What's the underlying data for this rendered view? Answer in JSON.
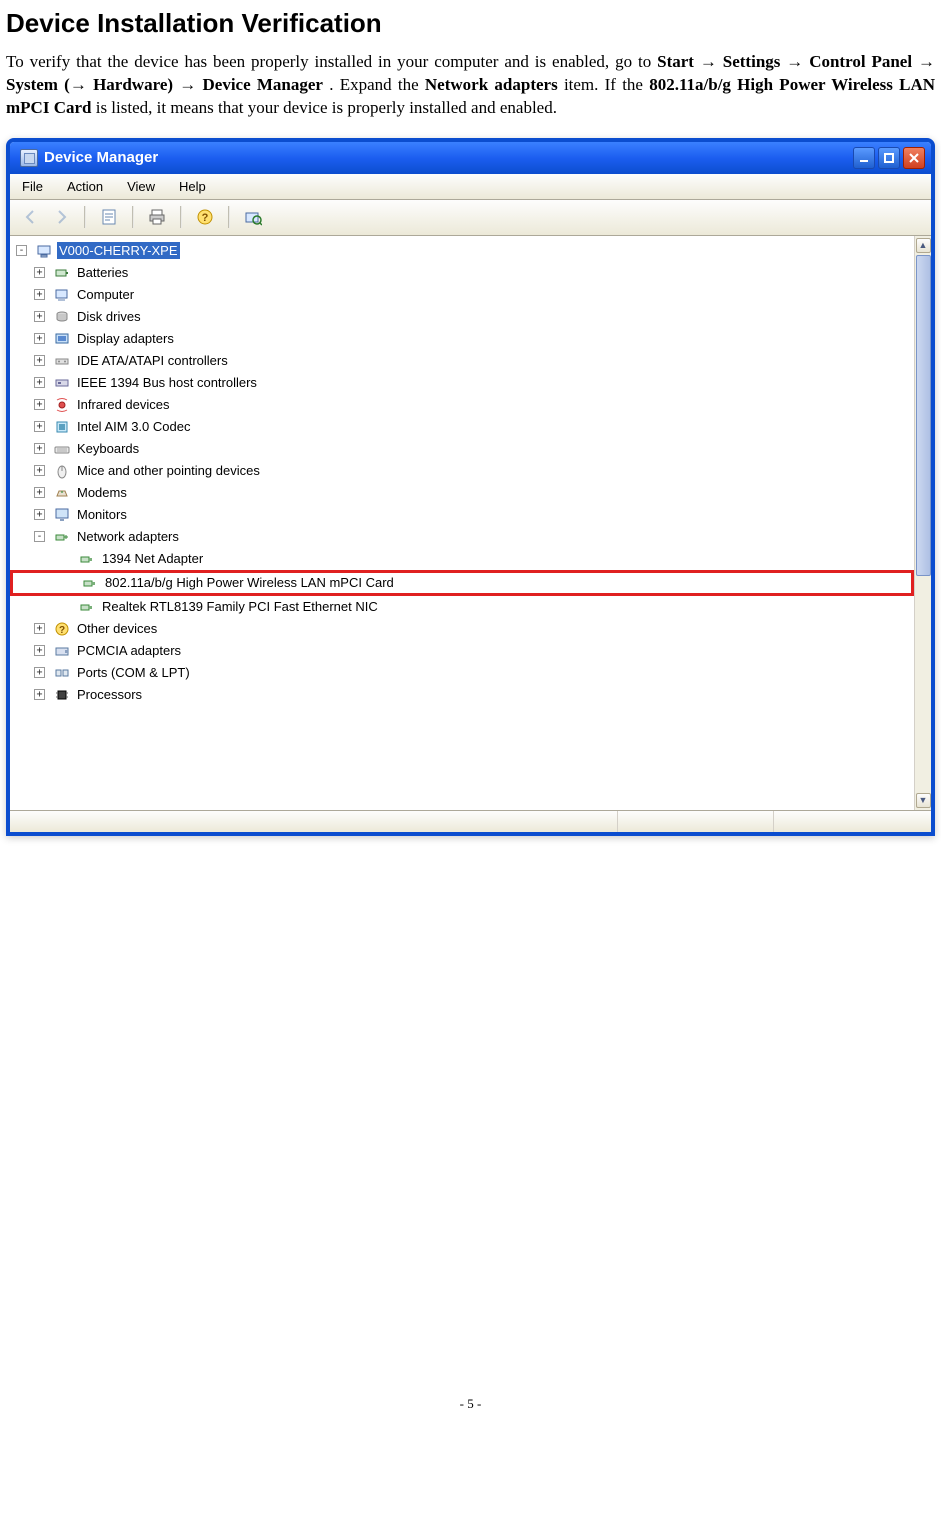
{
  "page": {
    "heading": "Device Installation Verification",
    "intro_plain": "To verify that the device has been properly installed in your computer and is enabled, go to Start → Settings → Control Panel → System (→ Hardware) → Device Manager. Expand the Network adapters item. If the 802.11a/b/g High Power Wireless LAN mPCI Card is listed, it means that your device is properly installed and enabled.",
    "intro_parts": {
      "p1": "To verify that the device has been properly installed in your computer and is enabled, go to ",
      "b1": "Start → Settings → Control Panel → System (→ Hardware) → Device Manager",
      "p2": ". Expand the ",
      "b2": "Network adapters",
      "p3": " item. If the ",
      "b3": "802.11a/b/g High Power Wireless LAN mPCI Card",
      "p4": " is listed, it means that your device is properly installed and enabled."
    },
    "footer": "- 5 -"
  },
  "window": {
    "title": "Device Manager"
  },
  "menubar": [
    {
      "label": "File"
    },
    {
      "label": "Action"
    },
    {
      "label": "View"
    },
    {
      "label": "Help"
    }
  ],
  "toolbar": [
    {
      "name": "back",
      "enabled": false,
      "icon": "arrow-left"
    },
    {
      "name": "forward",
      "enabled": false,
      "icon": "arrow-right"
    },
    {
      "sep": true
    },
    {
      "name": "properties",
      "enabled": true,
      "icon": "properties"
    },
    {
      "sep": true
    },
    {
      "name": "print",
      "enabled": true,
      "icon": "print"
    },
    {
      "sep": true
    },
    {
      "name": "help",
      "enabled": true,
      "icon": "help"
    },
    {
      "sep": true
    },
    {
      "name": "scan",
      "enabled": true,
      "icon": "scan"
    }
  ],
  "tree": {
    "root": {
      "icon": "computer-root",
      "label": "V000-CHERRY-XPE",
      "selected": true
    },
    "nodes": [
      {
        "exp": "+",
        "icon": "battery",
        "label": "Batteries"
      },
      {
        "exp": "+",
        "icon": "computer",
        "label": "Computer"
      },
      {
        "exp": "+",
        "icon": "disk",
        "label": "Disk drives"
      },
      {
        "exp": "+",
        "icon": "display",
        "label": "Display adapters"
      },
      {
        "exp": "+",
        "icon": "ide",
        "label": "IDE ATA/ATAPI controllers"
      },
      {
        "exp": "+",
        "icon": "ieee1394",
        "label": "IEEE 1394 Bus host controllers"
      },
      {
        "exp": "+",
        "icon": "infrared",
        "label": "Infrared devices"
      },
      {
        "exp": "+",
        "icon": "chip",
        "label": "Intel AIM 3.0 Codec"
      },
      {
        "exp": "+",
        "icon": "keyboard",
        "label": "Keyboards"
      },
      {
        "exp": "+",
        "icon": "mouse",
        "label": "Mice and other pointing devices"
      },
      {
        "exp": "+",
        "icon": "modem",
        "label": "Modems"
      },
      {
        "exp": "+",
        "icon": "monitor",
        "label": "Monitors"
      },
      {
        "exp": "-",
        "icon": "network",
        "label": "Network adapters",
        "children": [
          {
            "icon": "netcard",
            "label": "1394 Net Adapter"
          },
          {
            "icon": "netcard",
            "label": "802.11a/b/g High Power Wireless LAN mPCI Card",
            "highlight": true
          },
          {
            "icon": "netcard",
            "label": "Realtek RTL8139 Family PCI Fast Ethernet NIC"
          }
        ]
      },
      {
        "exp": "+",
        "icon": "other",
        "label": "Other devices"
      },
      {
        "exp": "+",
        "icon": "pcmcia",
        "label": "PCMCIA adapters"
      },
      {
        "exp": "+",
        "icon": "ports",
        "label": "Ports (COM & LPT)"
      },
      {
        "exp": "+",
        "icon": "processor",
        "label": "Processors"
      }
    ]
  }
}
